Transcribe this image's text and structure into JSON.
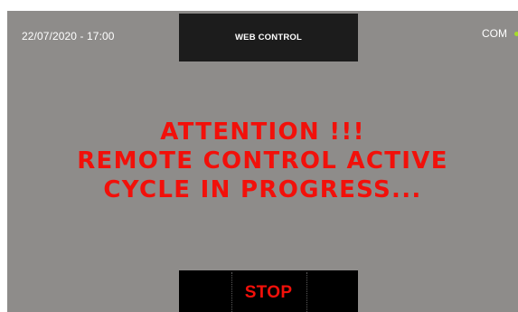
{
  "header": {
    "datetime": "22/07/2020 - 17:00",
    "title": "WEB CONTROL",
    "com_label": "COM",
    "com_led_color": "#a6dc2a"
  },
  "message": {
    "line1": "ATTENTION !!!",
    "line2": "REMOTE CONTROL ACTIVE",
    "line3": "CYCLE IN PROGRESS...",
    "color": "#f2100a"
  },
  "controls": {
    "stop_label": "STOP"
  },
  "colors": {
    "background": "#8e8c8a",
    "panel": "#1c1c1c",
    "button": "#000000",
    "alert": "#f2100a"
  }
}
